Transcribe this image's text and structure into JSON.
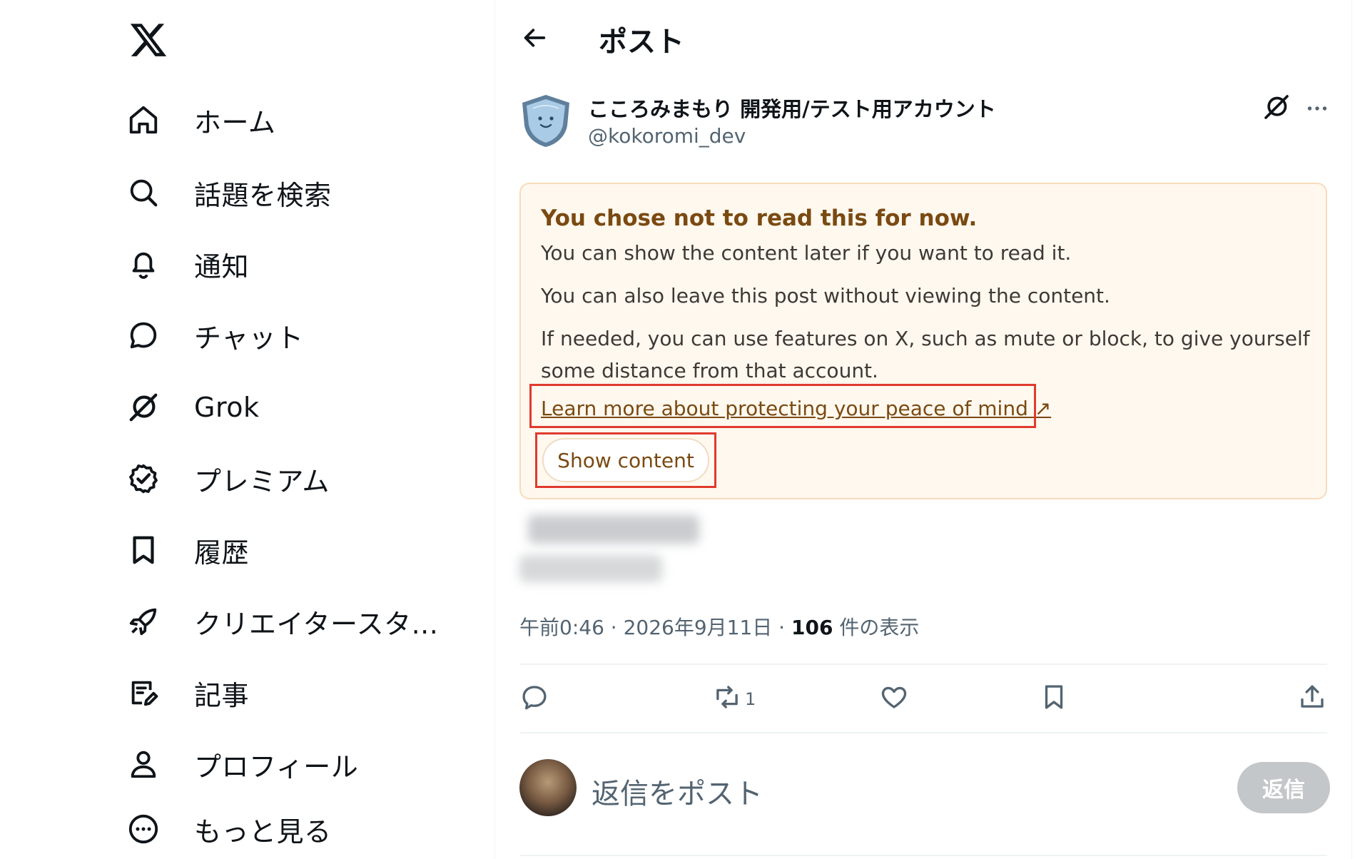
{
  "sidebar": {
    "items": [
      {
        "label": "ホーム",
        "icon": "home-icon"
      },
      {
        "label": "話題を検索",
        "icon": "search-icon"
      },
      {
        "label": "通知",
        "icon": "bell-icon"
      },
      {
        "label": "チャット",
        "icon": "chat-icon"
      },
      {
        "label": "Grok",
        "icon": "grok-icon"
      },
      {
        "label": "プレミアム",
        "icon": "verified-badge-icon"
      },
      {
        "label": "履歴",
        "icon": "bookmark-icon"
      },
      {
        "label": "クリエイタースタ...",
        "icon": "rocket-icon"
      },
      {
        "label": "記事",
        "icon": "article-icon"
      },
      {
        "label": "プロフィール",
        "icon": "person-icon"
      },
      {
        "label": "もっと見る",
        "icon": "more-circle-icon"
      }
    ]
  },
  "header": {
    "title": "ポスト"
  },
  "post": {
    "display_name": "こころみまもり 開発用/テスト用アカウント",
    "handle": "@kokoromi_dev",
    "timestamp": "午前0:46 · 2026年9月11日 · ",
    "views_count": "106",
    "views_label": " 件の表示",
    "retweet_count": "1"
  },
  "warning": {
    "title": "You chose not to read this for now.",
    "line1": "You can show the content later if you want to read it.",
    "line2": "You can also leave this post without viewing the content.",
    "line3": "If needed, you can use features on X, such as mute or block, to give yourself some distance from that account.",
    "learn_more": "Learn more about protecting your peace of mind ↗",
    "show_button": "Show content"
  },
  "reply": {
    "placeholder": "返信をポスト",
    "button": "返信"
  },
  "colors": {
    "accent_brown": "#7a4a12",
    "card_bg": "#fff8ef",
    "highlight_red": "#e03a2e"
  }
}
